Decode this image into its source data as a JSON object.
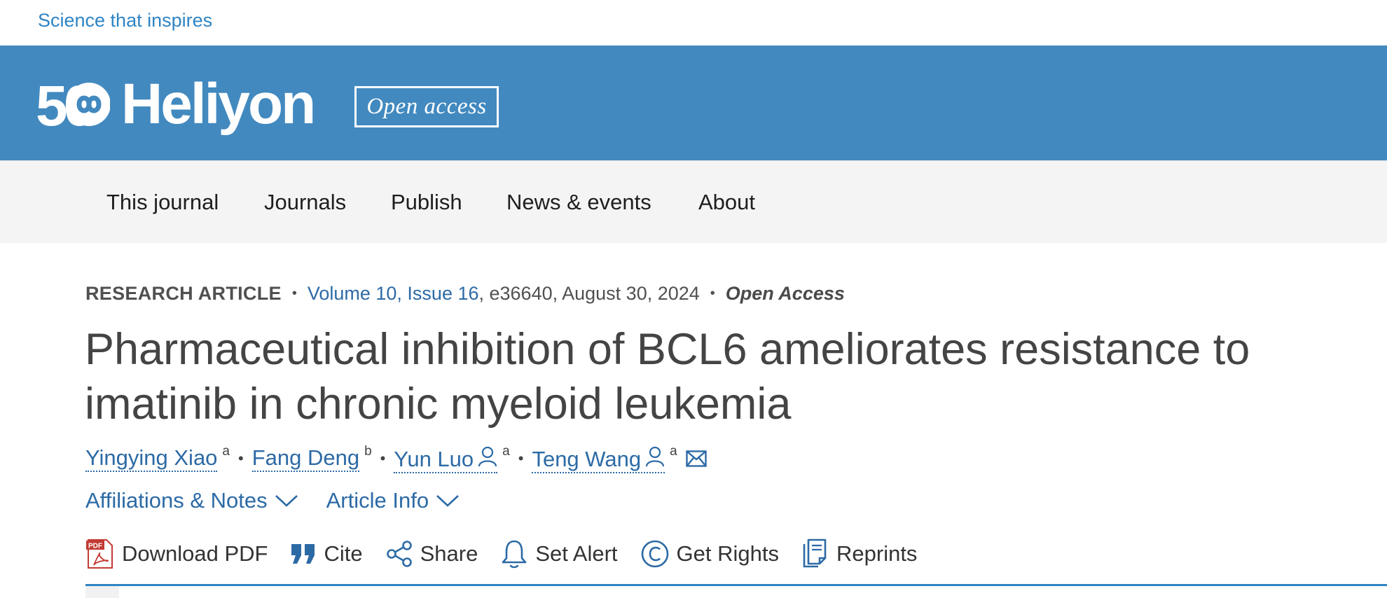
{
  "header": {
    "tagline": "Science that inspires",
    "logo_text": "Heliyon",
    "logo_mark": "50",
    "badge": "Open access",
    "brand_color": "#4289bf"
  },
  "nav": {
    "items": [
      {
        "label": "This journal"
      },
      {
        "label": "Journals"
      },
      {
        "label": "Publish"
      },
      {
        "label": "News & events"
      },
      {
        "label": "About"
      }
    ]
  },
  "article": {
    "type": "RESEARCH ARTICLE",
    "volume_issue": "Volume 10, Issue 16",
    "details": ", e36640, August 30, 2024",
    "access": "Open Access",
    "title": "Pharmaceutical inhibition of BCL6 ameliorates resistance to imatinib in chronic myeloid leukemia",
    "authors": [
      {
        "name": "Yingying Xiao",
        "aff": "a",
        "corresponding": false
      },
      {
        "name": "Fang Deng",
        "aff": "b",
        "corresponding": false
      },
      {
        "name": "Yun Luo",
        "aff": "a",
        "corresponding": true
      },
      {
        "name": "Teng Wang",
        "aff": "a",
        "corresponding": true
      }
    ],
    "author_icons": [
      "person-icon",
      "mail-icon"
    ],
    "expanders": [
      {
        "label": "Affiliations & Notes",
        "icon": "chevron-down-icon"
      },
      {
        "label": "Article Info",
        "icon": "chevron-down-icon"
      }
    ],
    "link_color": "#2c6aa5"
  },
  "toolbar": {
    "download_pdf": "Download PDF",
    "cite": "Cite",
    "share": "Share",
    "set_alert": "Set Alert",
    "get_rights": "Get Rights",
    "reprints": "Reprints",
    "pdf_badge": "PDF",
    "icons": [
      "pdf-icon",
      "quote-icon",
      "share-icon",
      "bell-icon",
      "copyright-icon",
      "reprints-icon"
    ]
  }
}
